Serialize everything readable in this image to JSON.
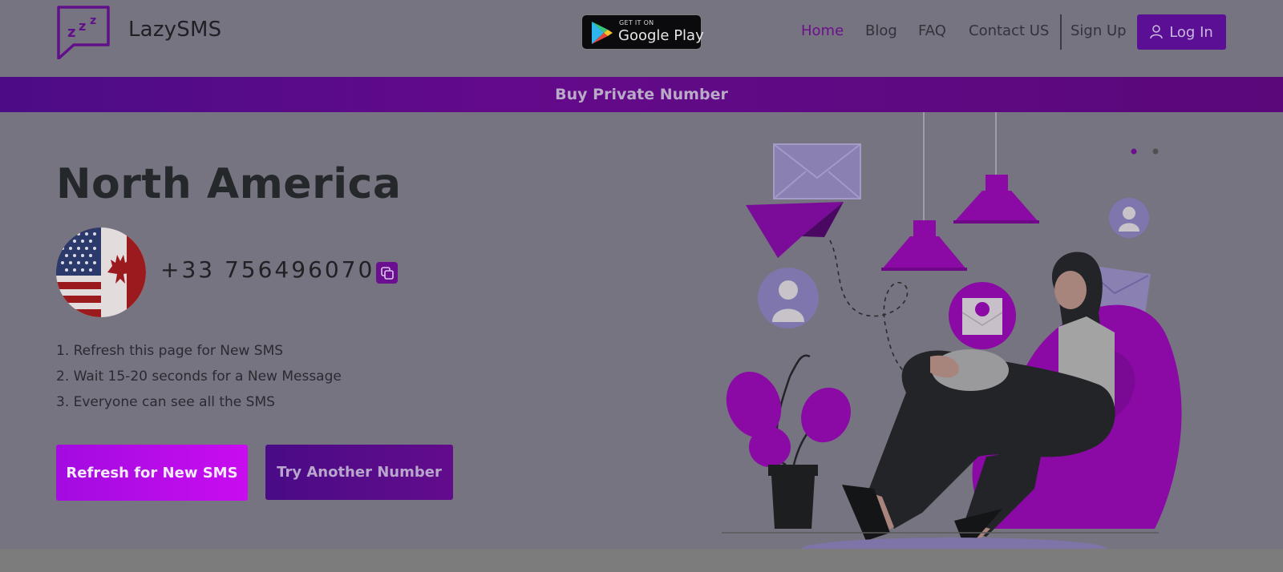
{
  "brand": {
    "name": "LazySMS",
    "logo_glyph": "zzz"
  },
  "store_badge": {
    "small_text": "GET IT ON",
    "big_text": "Google Play"
  },
  "nav": {
    "items": [
      {
        "label": "Home",
        "active": true
      },
      {
        "label": "Blog",
        "active": false
      },
      {
        "label": "FAQ",
        "active": false
      },
      {
        "label": "Contact US",
        "active": false
      },
      {
        "label": "Sign Up",
        "active": false
      }
    ],
    "login_label": "Log In"
  },
  "banner": {
    "label": "Buy Private Number"
  },
  "hero": {
    "region": "North America",
    "phone_number": "+33 756496070",
    "steps": [
      "1. Refresh this page for New SMS",
      "2. Wait 15-20 seconds for a New Message",
      "3. Everyone can see all the SMS"
    ],
    "refresh_button": "Refresh for New SMS",
    "another_button": "Try Another Number"
  },
  "colors": {
    "accent": "#6d0f8c",
    "banner": "#5a087a",
    "refresh_gradient_end": "#c90cf0",
    "background_overlay": "#767480"
  },
  "icons": {
    "copy": "copy-icon",
    "user": "user-icon",
    "play": "google-play-icon"
  }
}
